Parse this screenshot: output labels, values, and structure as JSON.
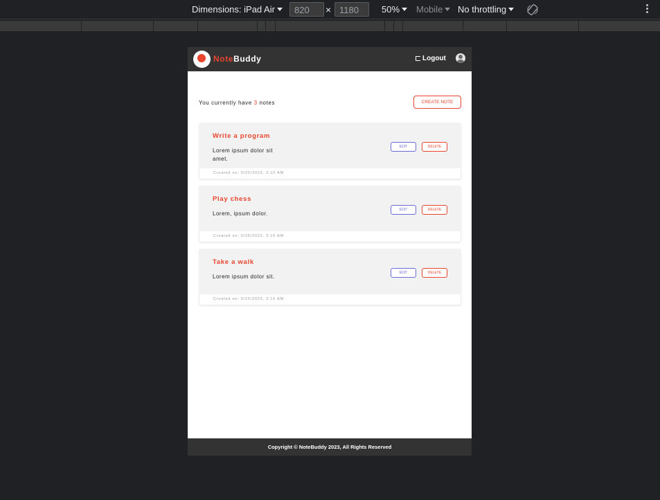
{
  "devtools": {
    "dimensions_label": "Dimensions: iPad Air",
    "width_value": "820",
    "height_value": "1180",
    "times": "×",
    "zoom": "50%",
    "mode": "Mobile",
    "throttling": "No throttling"
  },
  "app": {
    "brand_part1": "Note",
    "brand_part2": "Buddy",
    "logout_label": "Logout"
  },
  "notes_summary": {
    "prefix": "You currently have",
    "count": "3",
    "suffix": "notes"
  },
  "create_note_label": "CREATE NOTE",
  "notes": [
    {
      "title": "Write a program",
      "body": "Lorem ipsum dolor sit amet.",
      "created": "Created on: 5/25/2023, 2:15 AM",
      "edit_label": "EDIT",
      "delete_label": "DELETE"
    },
    {
      "title": "Play chess",
      "body": "Lorem, ipsum dolor.",
      "created": "Created on: 5/25/2023, 2:15 AM",
      "edit_label": "EDIT",
      "delete_label": "DELETE"
    },
    {
      "title": "Take a walk",
      "body": "Lorem ipsum dolor sit.",
      "created": "Created on: 5/25/2023, 2:15 AM",
      "edit_label": "EDIT",
      "delete_label": "DELETE"
    }
  ],
  "footer": {
    "copyright": "Copyright © NoteBuddy 2023, All Rights Reserved"
  },
  "colors": {
    "accent": "#e8442e",
    "header_bg": "#333333",
    "edit": "#6b6bd6"
  }
}
